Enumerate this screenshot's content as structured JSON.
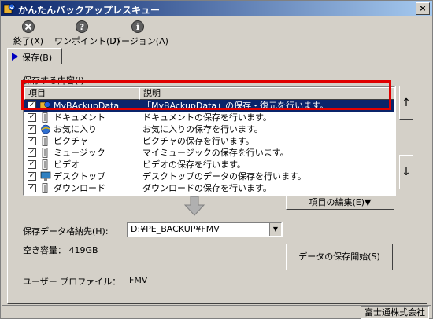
{
  "window": {
    "title": "かんたんバックアップレスキュー",
    "close_label": "×"
  },
  "toolbar": {
    "exit_label": "終了(X)",
    "onepoint_label": "ワンポイント(D)",
    "version_label": "バージョン(A)"
  },
  "tabs": [
    {
      "label": "保存(B)",
      "active": true
    }
  ],
  "content": {
    "section_label": "保存する内容(I)",
    "columns": [
      "項目",
      "説明"
    ],
    "rows": [
      {
        "item": "MyBAckupData",
        "desc": "「MyBAckupData」の保存・復元を行います。",
        "checked": true,
        "selected": true,
        "icon": "mybackup-icon"
      },
      {
        "item": "ドキュメント",
        "desc": "ドキュメントの保存を行います。",
        "checked": true,
        "icon": "folder-icon"
      },
      {
        "item": "お気に入り",
        "desc": "お気に入りの保存を行います。",
        "checked": true,
        "icon": "favorites-icon"
      },
      {
        "item": "ピクチャ",
        "desc": "ピクチャの保存を行います。",
        "checked": true,
        "icon": "folder-icon"
      },
      {
        "item": "ミュージック",
        "desc": "マイミュージックの保存を行います。",
        "checked": true,
        "icon": "folder-icon"
      },
      {
        "item": "ビデオ",
        "desc": "ビデオの保存を行います。",
        "checked": true,
        "icon": "folder-icon"
      },
      {
        "item": "デスクトップ",
        "desc": "デスクトップのデータの保存を行います。",
        "checked": true,
        "icon": "desktop-icon"
      },
      {
        "item": "ダウンロード",
        "desc": "ダウンロードの保存を行います。",
        "checked": true,
        "icon": "folder-icon"
      }
    ],
    "move_up_label": "↑",
    "move_down_label": "↓",
    "edit_items_label": "項目の編集(E)▼"
  },
  "destination": {
    "label": "保存データ格納先(H):",
    "value": "D:¥PE_BACKUP¥FMV",
    "free_space": "空き容量： 419GB"
  },
  "start_button_label": "データの保存開始(S)",
  "profile": {
    "label": "ユーザー プロファイル：",
    "value": "FMV"
  },
  "statusbar": {
    "company": "富士通株式会社"
  },
  "colors": {
    "selection": "#0a246a",
    "highlight_box": "#e00000",
    "tab_arrow": "#0000c0"
  }
}
